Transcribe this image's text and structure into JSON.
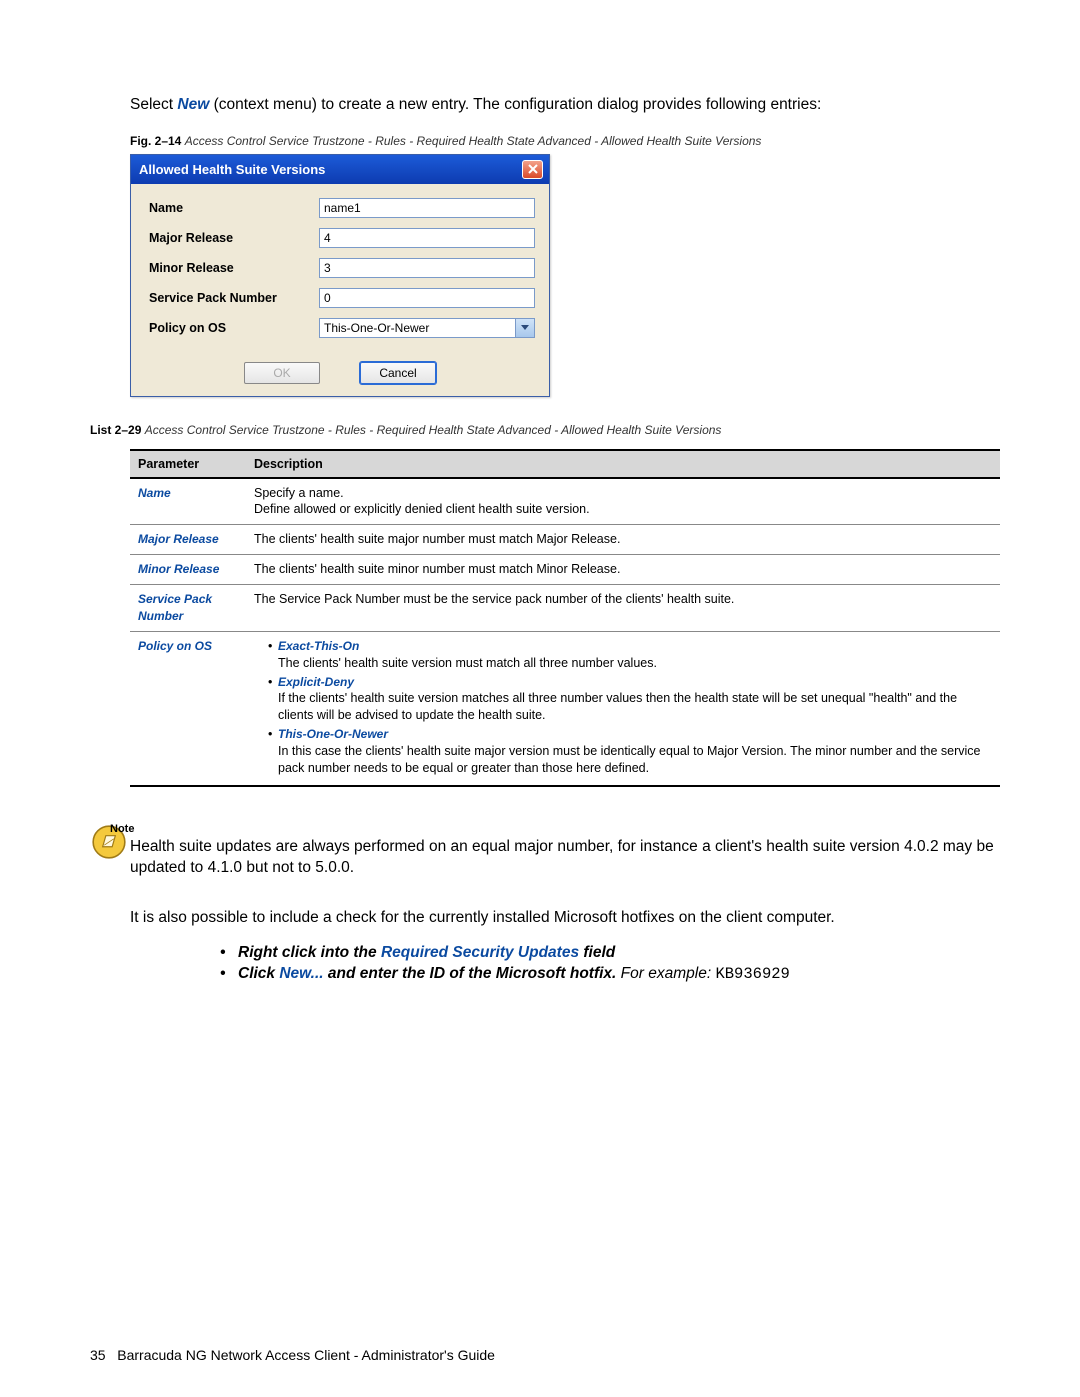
{
  "intro": {
    "pre": "Select ",
    "kw": "New",
    "post": " (context menu) to create a new entry. The configuration dialog provides following entries:"
  },
  "figCaption": {
    "label": "Fig. 2–14",
    "text": "Access Control Service Trustzone - Rules - Required Health State Advanced - Allowed Health Suite Versions"
  },
  "dialog": {
    "title": "Allowed Health Suite Versions",
    "fields": {
      "name": {
        "label": "Name",
        "value": "name1"
      },
      "major": {
        "label": "Major Release",
        "value": "4"
      },
      "minor": {
        "label": "Minor Release",
        "value": "3"
      },
      "sp": {
        "label": "Service Pack Number",
        "value": "0"
      },
      "policy": {
        "label": "Policy on OS",
        "value": "This-One-Or-Newer"
      }
    },
    "buttons": {
      "ok": "OK",
      "cancel": "Cancel"
    }
  },
  "listCaption": {
    "label": "List 2–29",
    "text": "Access Control Service Trustzone - Rules - Required Health State Advanced - Allowed Health Suite Versions"
  },
  "tableHeaders": {
    "param": "Parameter",
    "desc": "Description"
  },
  "rows": [
    {
      "name": "Name",
      "desc": "Specify a name.\nDefine allowed or explicitly denied client health suite version."
    },
    {
      "name": "Major Release",
      "desc": "The clients' health suite major number must match Major Release."
    },
    {
      "name": "Minor Release",
      "desc": "The clients' health suite minor number must match Minor Release."
    },
    {
      "name": "Service Pack Number",
      "desc": "The Service Pack Number must be the service pack number of the clients' health suite."
    }
  ],
  "policyRow": {
    "name": "Policy on OS",
    "items": [
      {
        "title": "Exact-This-On",
        "desc": "The clients' health suite version must match all three number values."
      },
      {
        "title": "Explicit-Deny",
        "desc": "If the clients' health suite version matches all three number values then the health state will be set unequal \"health\" and the clients will be advised to update the health suite."
      },
      {
        "title": "This-One-Or-Newer",
        "desc": "In this case the clients' health suite major version must be identically equal to Major Version. The minor number and the service pack number needs to be equal or greater than those here defined."
      }
    ]
  },
  "note": {
    "label": "Note",
    "body": "Health suite updates are always performed on an equal major number, for instance a client's health suite version 4.0.2 may be updated to 4.1.0 but not to 5.0.0."
  },
  "paragraph2": "It is also possible to include a check for the currently installed Microsoft hotfixes on the client computer.",
  "instr": {
    "line1": {
      "pre": "Right click into the ",
      "link": "Required Security Updates",
      "post": " field"
    },
    "line2": {
      "pre": "Click ",
      "link": "New...",
      "mid": " and enter the ID of the Microsoft hotfix.",
      "ex": " For example: ",
      "code": "KB936929"
    }
  },
  "footer": {
    "page": "35",
    "title": "Barracuda NG Network Access Client - Administrator's Guide"
  }
}
